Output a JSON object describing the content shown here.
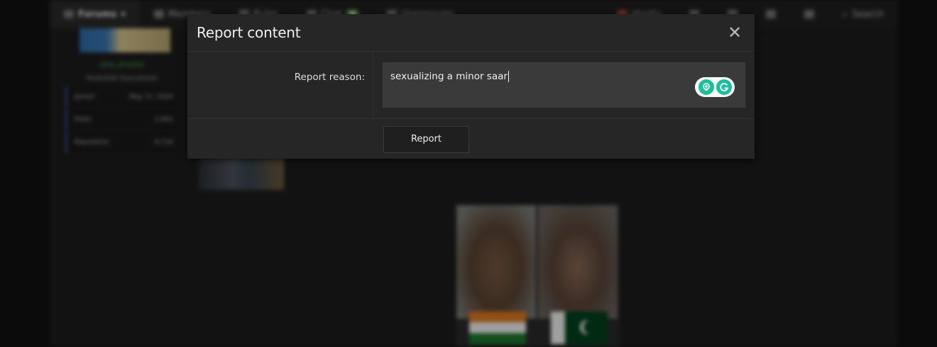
{
  "background": {
    "nav": {
      "items": [
        {
          "label": "Forums",
          "icon": "chat-bubbles-icon"
        },
        {
          "label": "Members",
          "icon": "people-icon"
        },
        {
          "label": "Rules",
          "icon": "book-icon"
        },
        {
          "label": "Chat",
          "icon": "chat-icon"
        },
        {
          "label": "Usergroups",
          "icon": "group-icon"
        }
      ],
      "right_items": [
        "shorty",
        "Search"
      ]
    },
    "user": {
      "name": "akla_jihadist",
      "title": "Hezbollah Executioner",
      "stats": [
        {
          "label": "Joined",
          "value": "May 11, 2024"
        },
        {
          "label": "Posts",
          "value": "2,841"
        },
        {
          "label": "Reputation",
          "value": "6,716"
        }
      ]
    }
  },
  "modal": {
    "title": "Report content",
    "reason_label": "Report reason:",
    "reason_value": "sexualizing a minor saar",
    "submit_label": "Report"
  },
  "colors": {
    "page_bg": "#111111",
    "modal_bg": "#262626",
    "input_bg": "#3a3a3a",
    "grammarly_green": "#15c39a",
    "username_green": "#4caf50"
  }
}
